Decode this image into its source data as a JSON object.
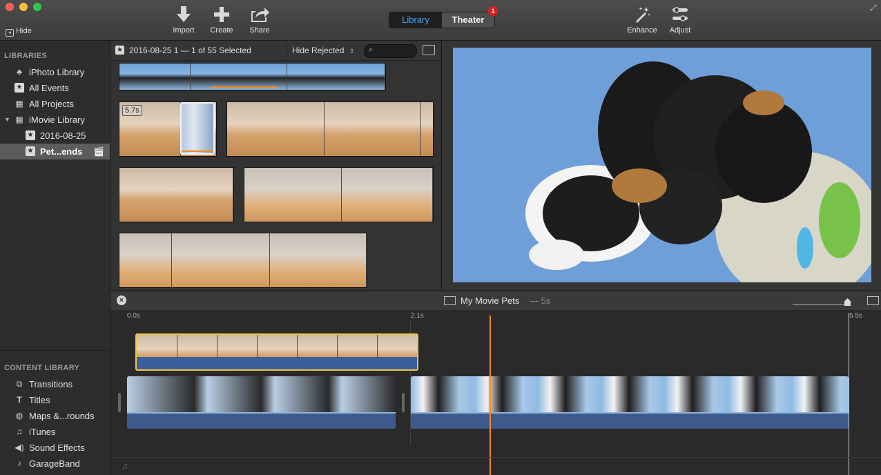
{
  "toolbar": {
    "hide_label": "Hide",
    "import_label": "Import",
    "create_label": "Create",
    "share_label": "Share",
    "library_tab": "Library",
    "theater_tab": "Theater",
    "theater_badge": "1",
    "enhance_label": "Enhance",
    "adjust_label": "Adjust"
  },
  "sidebar": {
    "libraries_title": "LIBRARIES",
    "libraries": [
      {
        "label": "iPhoto Library",
        "icon": "palm-tree-icon"
      },
      {
        "label": "All Events",
        "icon": "star-icon"
      },
      {
        "label": "All Projects",
        "icon": "grid-icon"
      },
      {
        "label": "iMovie Library",
        "icon": "grid-icon"
      },
      {
        "label": "2016-08-25",
        "icon": "star-icon"
      },
      {
        "label": "Pet...ends",
        "icon": "star-icon"
      }
    ],
    "content_title": "CONTENT LIBRARY",
    "content": [
      {
        "label": "Transitions",
        "icon": "transitions-icon"
      },
      {
        "label": "Titles",
        "icon": "titles-icon"
      },
      {
        "label": "Maps &...rounds",
        "icon": "globe-icon"
      },
      {
        "label": "iTunes",
        "icon": "music-note-icon"
      },
      {
        "label": "Sound Effects",
        "icon": "speaker-icon"
      },
      {
        "label": "GarageBand",
        "icon": "guitar-icon"
      }
    ]
  },
  "browser": {
    "event_title": "2016-08-25 1 — 1 of 55 Selected",
    "filter_label": "Hide Rejected",
    "clip_duration": "5.7s"
  },
  "timeline": {
    "project_title": "My Movie Pets",
    "project_duration": "— 5s",
    "ticks": [
      "0.0s",
      "2.1s",
      "5.5s"
    ]
  },
  "colors": {
    "accent_blue": "#4ba3f5",
    "playhead": "#f08a24",
    "selection": "#f2c53d",
    "badge": "#e01e1e"
  }
}
